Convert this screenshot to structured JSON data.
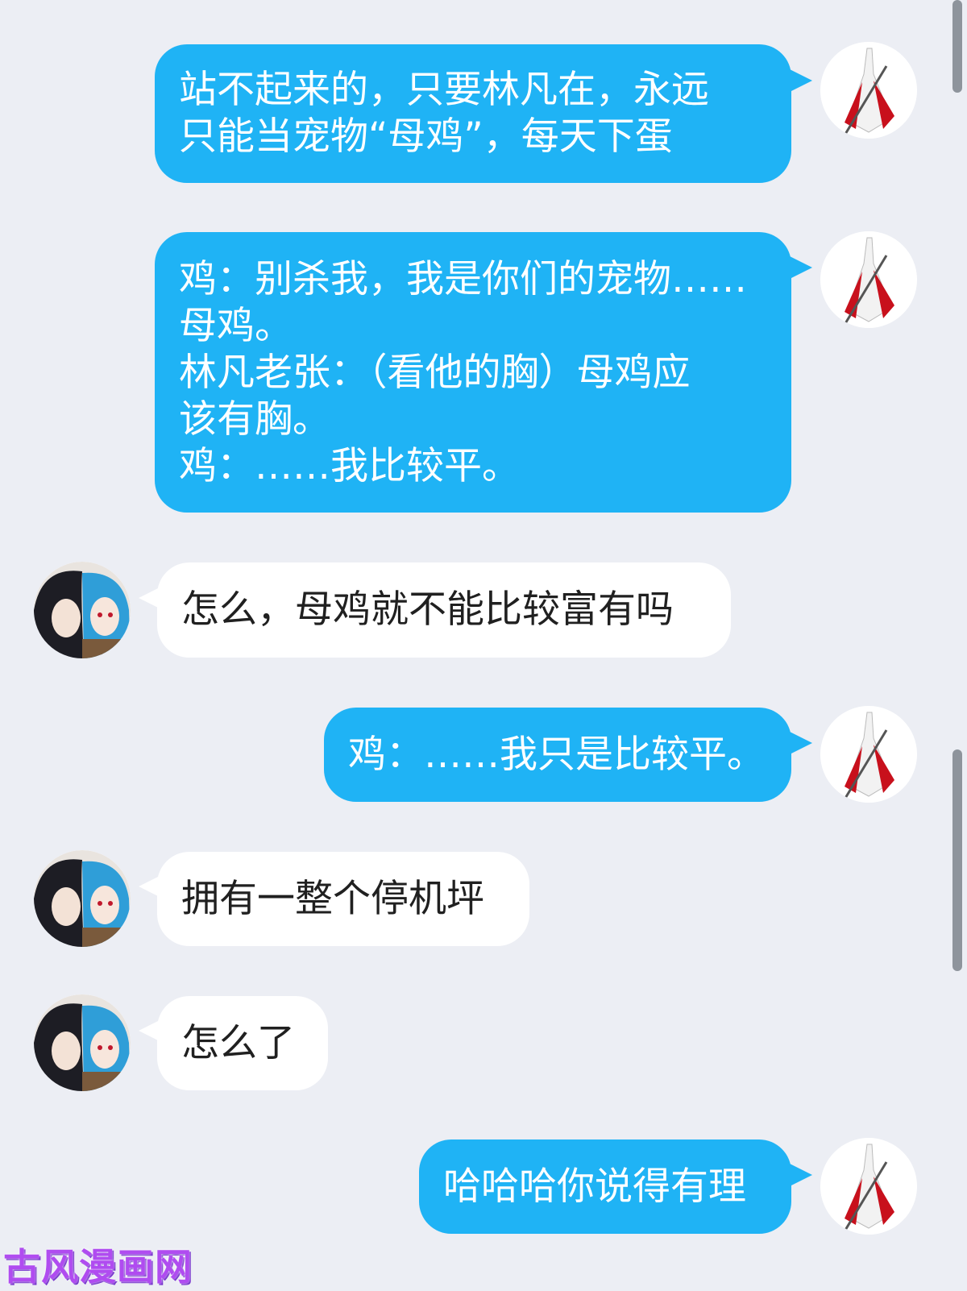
{
  "messages": [
    {
      "side": "out",
      "text": "站不起来的，只要林凡在，永远\n只能当宠物“母鸡”，每天下蛋",
      "avatar": "warrior-avatar"
    },
    {
      "side": "out",
      "text": "鸡：别杀我，我是你们的宠物……\n母鸡。\n林凡老张：（看他的胸）母鸡应\n该有胸。\n鸡：……我比较平。",
      "avatar": "warrior-avatar"
    },
    {
      "side": "in",
      "text": "怎么，母鸡就不能比较富有吗",
      "avatar": "duo-avatar"
    },
    {
      "side": "out",
      "text": "鸡：……我只是比较平。",
      "avatar": "warrior-avatar"
    },
    {
      "side": "in",
      "text": "拥有一整个停机坪",
      "avatar": "duo-avatar"
    },
    {
      "side": "in",
      "text": "怎么了",
      "avatar": "duo-avatar"
    },
    {
      "side": "out",
      "text": "哈哈哈你说得有理",
      "avatar": "warrior-avatar"
    }
  ],
  "watermark": "古风漫画网",
  "colors": {
    "outgoing_bubble": "#1fb3f5",
    "incoming_bubble": "#ffffff",
    "background": "#eceef4",
    "watermark": "#b04cf0"
  }
}
